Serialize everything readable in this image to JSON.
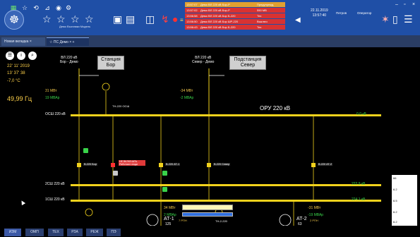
{
  "topbar": {
    "logo_text": "☸",
    "tools": [
      {
        "icon": "☆",
        "caption": ""
      },
      {
        "icon": "☆",
        "caption": ""
      },
      {
        "icon": "☆",
        "caption": "Демо Выставки Модель"
      },
      {
        "icon": "☆",
        "caption": ""
      }
    ],
    "events": [
      {
        "time": "13:57:07",
        "text": "Демо ВЛ 220 кВ Бор-Р",
        "state": "Предупрежд.",
        "color": "#e0a030"
      },
      {
        "time": "13:57:02",
        "text": "Демо ВЛ 220 кВ Бор-Р",
        "state": "550 МВ",
        "color": "#e03030"
      },
      {
        "time": "13:56:58",
        "text": "Демо ВЛ 220 кВ Бор Б-220",
        "state": "Тех",
        "color": "#e03030"
      },
      {
        "time": "13:56:50",
        "text": "Демо ВЛ 220 кВ Бор ШР-220",
        "state": "Выключ",
        "color": "#e03030"
      },
      {
        "time": "13:56:43",
        "text": "Демо ВЛ 220 кВ Бор Б-220",
        "state": "Тех",
        "color": "#e03030"
      }
    ],
    "clock_date": "22.11.2019",
    "clock_time": "13:57:40",
    "user": "Петров",
    "role": "Оператор"
  },
  "tabs": [
    {
      "label": "Новая вкладка ×"
    },
    {
      "label": "☆  ПС Демо  ×  +"
    }
  ],
  "scheme": {
    "date": "22' 11' 2019",
    "time": "13' 37' 38",
    "temperature": "-7,0 °C",
    "frequency": "49,99 Гц",
    "left_power_mw": "31 МВт",
    "left_power_mvar": "19 МВАр",
    "right_power_mw": "-34 МВт",
    "right_power_mvar": "-2 МВАр",
    "line_bor": "ВЛ 220 кВ\nБор - Демо",
    "line_sever": "ВЛ 220 кВ\nСевер - Демо",
    "station_bor": "Станция\nБор",
    "station_sever": "Подстанция\nСевер",
    "oru_label": "ОРУ 220 кВ",
    "tn_osh": "ТН-220 ОСШ",
    "bus_osh": "ОСШ 220 кВ",
    "bus_osh_kv": "0,0 кВ",
    "bus_2sh": "2СШ 220 кВ",
    "bus_2sh_kv": "222,9 кВ",
    "bus_1sh": "1СШ 220 кВ",
    "bus_1sh_kv": "224,1 кВ",
    "breakers": [
      "В-220 Бор",
      "В-220 АТ-1",
      "В-220 Север",
      "В-220 АТ-2"
    ],
    "warning_tag": "НЕ ВКЛЮЧАТЬ Работают люди",
    "at1_mw": "34 МВт",
    "at1_mvar": "2 МВАр",
    "at2_mw": "-31 МВт",
    "at2_mvar": "-19 МВАр",
    "at1_label": "АТ-1",
    "at1_sub": "125",
    "at1_rpn": "7 РПН",
    "at2_label": "АТ-2",
    "at2_sub": "63",
    "at2_rpn": "2 РПН",
    "tn_2sh": "ТН-2-220",
    "side_values": [
      "66",
      "6.2",
      "6.5",
      "6.2",
      "6.2"
    ],
    "add_icon": "+"
  },
  "bottom_tabs": [
    "ИЗМ",
    "ОМП",
    "ТЕХ",
    "РЗА",
    "РЕЖ",
    "ПЭ"
  ],
  "colors": {
    "bus_yellow": "#f2d21c",
    "mw": "#f2c84b",
    "mvar": "#39d34a",
    "topbar": "#1f4fa6"
  }
}
